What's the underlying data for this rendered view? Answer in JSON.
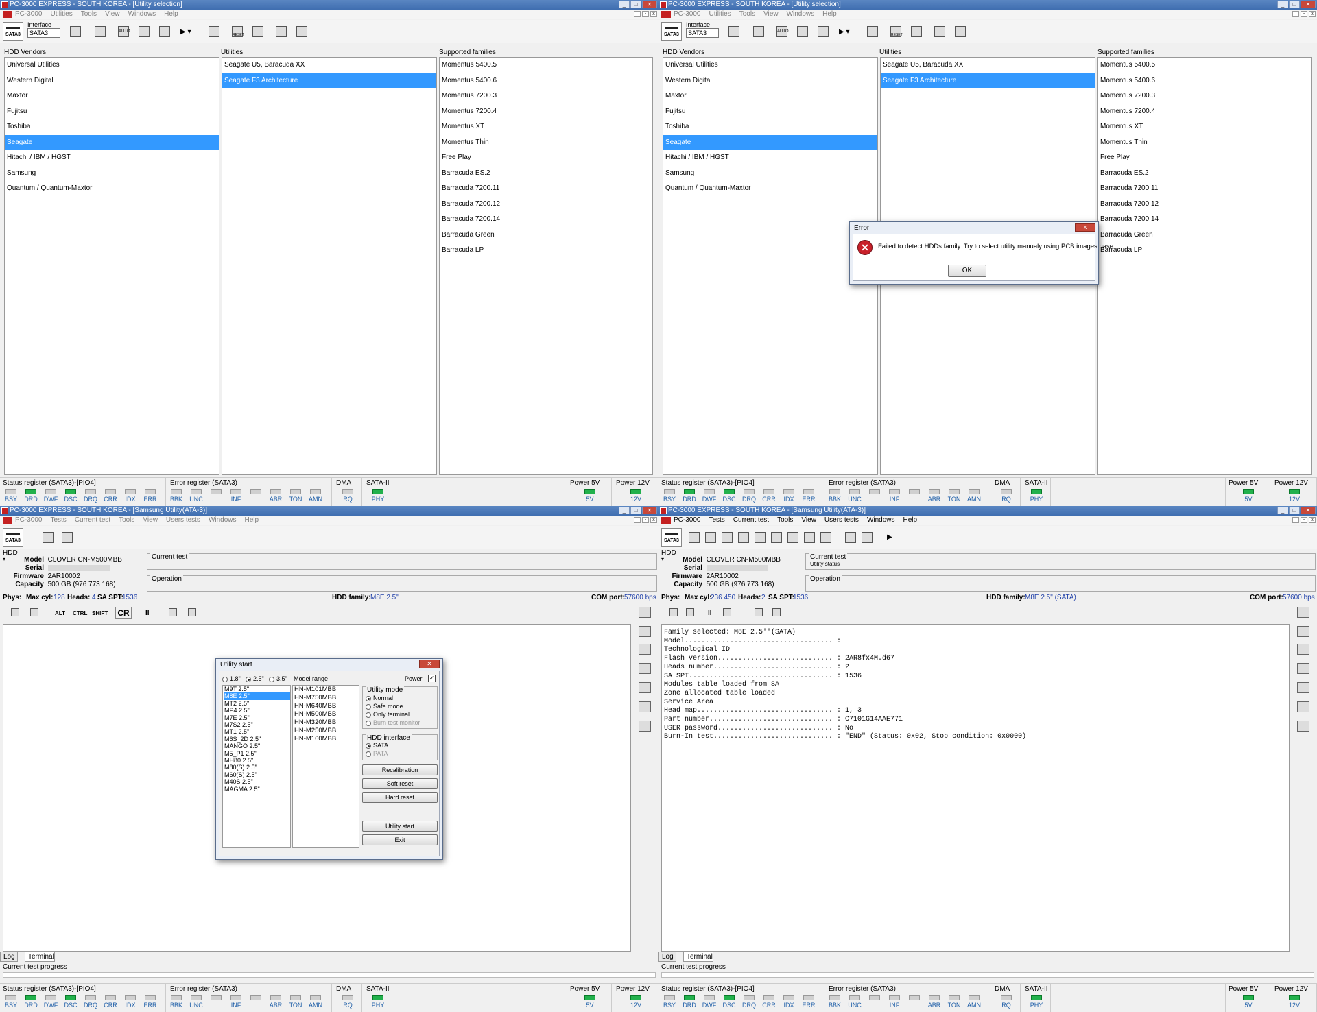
{
  "app": {
    "title_utility_selection": "PC-3000 EXPRESS - SOUTH KOREA - [Utility selection]",
    "title_samsung": "PC-3000 EXPRESS - SOUTH KOREA - [Samsung Utility(ATA-3)]"
  },
  "menus": {
    "utility_selection": [
      "PC-3000",
      "Utilities",
      "Tools",
      "View",
      "Windows",
      "Help"
    ],
    "samsung": [
      "PC-3000",
      "Tests",
      "Current test",
      "Tools",
      "View",
      "Users tests",
      "Windows",
      "Help"
    ]
  },
  "toolbar": {
    "sata_label": "SATA3",
    "interface_label": "Interface",
    "interface_value": "SATA3",
    "reset_label": "RESET",
    "auto_label": "AUTO"
  },
  "selection": {
    "vendors_header": "HDD Vendors",
    "utilities_header": "Utilities",
    "families_header": "Supported families",
    "vendors": [
      "Universal Utilities",
      "Western Digital",
      "Maxtor",
      "Fujitsu",
      "Toshiba",
      "Seagate",
      "Hitachi / IBM / HGST",
      "Samsung",
      "Quantum / Quantum-Maxtor"
    ],
    "selected_vendor": "Seagate",
    "utilities": [
      "Seagate U5, Baracuda XX",
      "Seagate F3 Architecture"
    ],
    "selected_utility": "Seagate F3 Architecture",
    "families": [
      "Momentus 5400.5",
      "Momentus 5400.6",
      "Momentus 7200.3",
      "Momentus 7200.4",
      "Momentus XT",
      "Momentus Thin",
      "Free Play",
      "Barracuda ES.2",
      "Barracuda 7200.11",
      "Barracuda 7200.12",
      "Barracuda 7200.14",
      "Barracuda Green",
      "Barracuda LP"
    ]
  },
  "error_dialog": {
    "title": "Error",
    "close": "x",
    "message": "Failed to detect HDDs family. Try to select utility manualy using PCB images base.",
    "ok": "OK"
  },
  "status": {
    "status_register": "Status register (SATA3)-[PIO4]",
    "error_register": "Error register (SATA3)",
    "dma": "DMA",
    "sata2": "SATA-II",
    "power5": "Power 5V",
    "power12": "Power 12V",
    "status_leds": [
      {
        "label": "BSY",
        "on": false
      },
      {
        "label": "DRD",
        "on": true
      },
      {
        "label": "DWF",
        "on": false
      },
      {
        "label": "DSC",
        "on": true
      },
      {
        "label": "DRQ",
        "on": false
      },
      {
        "label": "CRR",
        "on": false
      },
      {
        "label": "IDX",
        "on": false
      },
      {
        "label": "ERR",
        "on": false
      }
    ],
    "error_leds": [
      {
        "label": "BBK",
        "on": false
      },
      {
        "label": "UNC",
        "on": false
      },
      {
        "label": "",
        "on": false
      },
      {
        "label": "INF",
        "on": false
      },
      {
        "label": "",
        "on": false
      },
      {
        "label": "ABR",
        "on": false
      },
      {
        "label": "TON",
        "on": false
      },
      {
        "label": "AMN",
        "on": false
      }
    ],
    "rq": "RQ",
    "phy": "PHY",
    "v5": "5V",
    "v12": "12V",
    "led_on_color": "#22b14c"
  },
  "hdd": {
    "group": "HDD",
    "model_label": "Model",
    "model": "CLOVER  CN-M500MBB",
    "serial_label": "Serial",
    "firmware_label": "Firmware",
    "firmware": "2AR10002",
    "capacity_label": "Capacity",
    "capacity": "500 GB (976 773 168)",
    "current_test": "Current test",
    "operation": "Operation",
    "utility_status": "Utility status",
    "phys": "Phys:",
    "maxcyl_label": "Max cyl:",
    "heads_label": "Heads:",
    "saspt_label": "SA SPT:",
    "saspt": "1536",
    "family_label": "HDD family:",
    "com_label": "COM port:",
    "com": "57600 bps",
    "left": {
      "maxcyl": "128",
      "heads": "4",
      "family": "M8E 2.5\""
    },
    "right": {
      "maxcyl": "236 450",
      "heads": "2",
      "family": "M8E 2.5\" (SATA)"
    }
  },
  "term_tools": {
    "alt": "ALT",
    "ctrl": "CTRL",
    "shift": "SHIFT",
    "cr": "CR",
    "pause": "II"
  },
  "tabs": {
    "log": "Log",
    "terminal": "Terminal"
  },
  "progress": {
    "label": "Current test progress"
  },
  "utility_start": {
    "title": "Utility start",
    "size_18": "1.8\"",
    "size_25": "2.5\"",
    "size_35": "3.5\"",
    "model_range": "Model range",
    "power": "Power",
    "families": [
      "M9T 2.5\"",
      "M8E 2.5\"",
      "MT2 2.5\"",
      "MP4 2.5\"",
      "M7E 2.5\"",
      "M7S2 2.5\"",
      "MT1 2.5\"",
      "M6S_2D 2.5\"",
      "MANGO 2.5\"",
      "M5_P1 2.5\"",
      "MH80 2.5\"",
      "M80(S) 2.5\"",
      "M60(S) 2.5\"",
      "M40S 2.5\"",
      "MAGMA 2.5\""
    ],
    "selected_family": "M8E 2.5\"",
    "models": [
      "HN-M101MBB",
      "HN-M750MBB",
      "HN-M640MBB",
      "HN-M500MBB",
      "HN-M320MBB",
      "HN-M250MBB",
      "HN-M160MBB"
    ],
    "utility_mode": "Utility mode",
    "mode_normal": "Normal",
    "mode_safe": "Safe mode",
    "mode_terminal": "Only terminal",
    "mode_burn": "Burn test monitor",
    "hdd_interface": "HDD interface",
    "if_sata": "SATA",
    "if_pata": "PATA",
    "recalibration": "Recalibration",
    "soft_reset": "Soft reset",
    "hard_reset": "Hard reset",
    "start": "Utility start",
    "exit": "Exit"
  },
  "terminal_output": [
    "Family selected: M8E 2.5''(SATA)",
    "Model.................................... :",
    "",
    "Technological ID",
    "Flash version............................ : 2AR8fx4M.d67",
    "Heads number............................. : 2",
    "SA SPT................................... : 1536",
    "",
    "Modules table loaded from SA",
    "",
    "Zone allocated table loaded",
    "",
    "Service Area",
    "Head map................................. : 1, 3",
    "Part number.............................. : C7101G14AAE771",
    "USER password............................ : No",
    "Burn-In test............................. : \"END\" (Status: 0x02, Stop condition: 0x0000)"
  ]
}
